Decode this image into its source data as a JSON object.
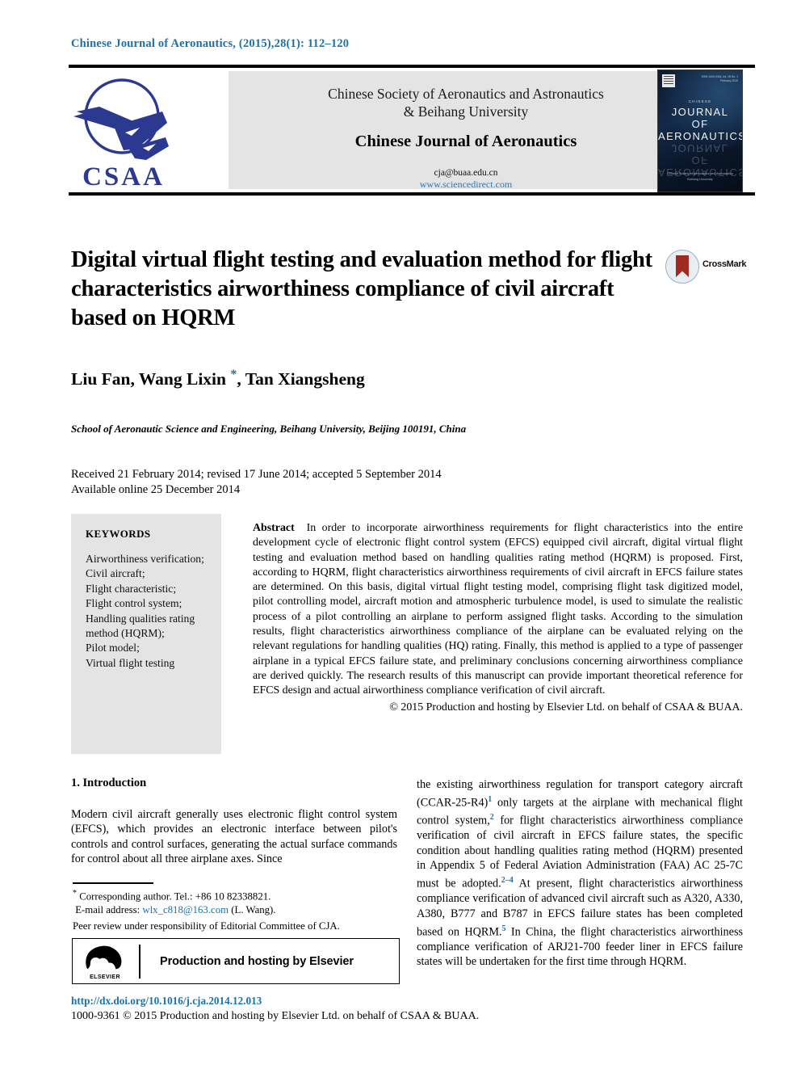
{
  "running_head": "Chinese Journal of Aeronautics, (2015),28(1): 112–120",
  "masthead": {
    "society_line1": "Chinese Society of Aeronautics and Astronautics",
    "society_line2": "& Beihang University",
    "journal_title": "Chinese Journal of Aeronautics",
    "email": "cja@buaa.edu.cn",
    "website": "www.sciencedirect.com",
    "logo_text": "CSAA",
    "logo_icon": "csaa-aircraft-logo",
    "cover": {
      "chinese_label": "CHINESE",
      "line1": "JOURNAL",
      "line2": "OF",
      "line3": "AERONAUTICS",
      "meta": "ISSN 1000-9361  Vol. 28  No. 1  February 2015",
      "footer1": "Chinese Society of Aeronautics and Astronautics",
      "footer2": "Beihang University",
      "publisher_icon": "elsevier-tree-icon"
    }
  },
  "article": {
    "title": "Digital virtual flight testing and evaluation method for flight characteristics airworthiness compliance of civil aircraft based on HQRM",
    "crossmark_label": "CrossMark",
    "crossmark_icon": "crossmark-ribbon-icon",
    "authors_pre": "Liu Fan, Wang Lixin ",
    "authors_star": "*",
    "authors_post": ", Tan Xiangsheng",
    "affiliation": "School of Aeronautic Science and Engineering, Beihang University, Beijing 100191, China",
    "received_line": "Received 21 February 2014; revised 17 June 2014; accepted 5 September 2014",
    "available_line": "Available online 25 December 2014"
  },
  "keywords": {
    "heading": "KEYWORDS",
    "items": [
      "Airworthiness verification;",
      "Civil aircraft;",
      "Flight characteristic;",
      "Flight control system;",
      "Handling qualities rating method (HQRM);",
      "Pilot model;",
      "Virtual flight testing"
    ]
  },
  "abstract": {
    "label": "Abstract",
    "text": "In order to incorporate airworthiness requirements for flight characteristics into the entire development cycle of electronic flight control system (EFCS) equipped civil aircraft, digital virtual flight testing and evaluation method based on handling qualities rating method (HQRM) is proposed. First, according to HQRM, flight characteristics airworthiness requirements of civil aircraft in EFCS failure states are determined. On this basis, digital virtual flight testing model, comprising flight task digitized model, pilot controlling model, aircraft motion and atmospheric turbulence model, is used to simulate the realistic process of a pilot controlling an airplane to perform assigned flight tasks. According to the simulation results, flight characteristics airworthiness compliance of the airplane can be evaluated relying on the relevant regulations for handling qualities (HQ) rating. Finally, this method is applied to a type of passenger airplane in a typical EFCS failure state, and preliminary conclusions concerning airworthiness compliance are derived quickly. The research results of this manuscript can provide important theoretical reference for EFCS design and actual airworthiness compliance verification of civil aircraft.",
    "copyright": "© 2015 Production and hosting by Elsevier Ltd. on behalf of CSAA & BUAA."
  },
  "body": {
    "section_heading": "1. Introduction",
    "left_paragraph": "Modern civil aircraft generally uses electronic flight control system (EFCS), which provides an electronic interface between pilot's controls and control surfaces, generating the actual surface commands for control about all three airplane axes. Since"
  },
  "footnotes": {
    "corresponding": "Corresponding author. Tel.: +86 10 82338821.",
    "email_label": "E-mail address:",
    "email": "wlx_c818@163.com",
    "email_suffix": "(L. Wang).",
    "peer_review": "Peer review under responsibility of Editorial Committee of CJA.",
    "elsevier_box_text": "Production and hosting by Elsevier",
    "elsevier_wordmark": "ELSEVIER",
    "doi": "http://dx.doi.org/10.1016/j.cja.2014.12.013",
    "issn_line": "1000-9361 © 2015 Production and hosting by Elsevier Ltd. on behalf of CSAA & BUAA."
  },
  "colors": {
    "link_blue": "#1a72a8",
    "panel_gray": "#e4e4e4",
    "logo_blue": "#2b3990",
    "crossmark_red": "#9e2a21"
  }
}
